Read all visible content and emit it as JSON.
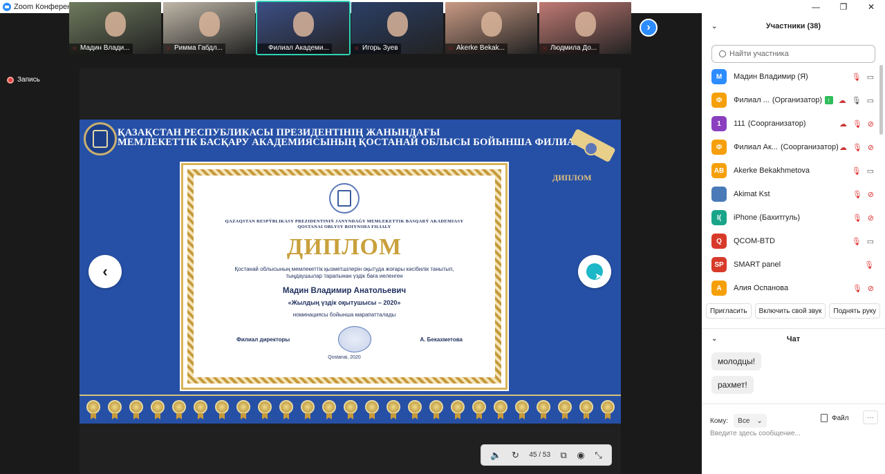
{
  "window": {
    "title": "Zoom Конференция"
  },
  "recording": {
    "label": "Запись"
  },
  "video_strip": [
    {
      "name": "Мадин Влади...",
      "bg": "#6f7a5e",
      "muted": true
    },
    {
      "name": "Римма Габдл...",
      "bg": "#bfb7a8",
      "muted": true
    },
    {
      "name": "Филиал Академи...",
      "bg": "#3c4f86",
      "muted": false
    },
    {
      "name": "Игорь Зуев",
      "bg": "#2b3f66",
      "muted": true
    },
    {
      "name": "Akerke Bekak...",
      "bg": "#c99a84",
      "muted": true
    },
    {
      "name": "Людмила До...",
      "bg": "#c07a74",
      "muted": true
    }
  ],
  "slide": {
    "header_line1": "ҚАЗАҚСТАН РЕСПУБЛИКАСЫ ПРЕЗИДЕНТІНІҢ ЖАНЫНДАҒЫ",
    "header_line2": "МЕМЛЕКЕТТІК БАСҚАРУ АКАДЕМИЯСЫНЫҢ ҚОСТАНАЙ ОБЛЫСЫ БОЙЫНША ФИЛИАЛЫ",
    "diplom_label": "ДИПЛОМ",
    "cert_org_line1": "QAZAQSTAN RESPÝBLIKASY PREZIDENTINIŃ JANYNDAǴY MEMLEKETTIK BASQARÝ AKADEMIASY",
    "cert_org_line2": "QOSTANAI OBLYSY BOIYNSHA FILIALY",
    "cert_title": "ДИПЛОМ",
    "cert_sub1": "Қостанай облысының мемлекеттік қызметшілерін оқытуда жоғары кәсібилік танытып,",
    "cert_sub2": "тыңдаушылар тарапынан үздік баға иеленген",
    "cert_person": "Мадин Владимир Анатольевич",
    "cert_nomination": "«Жылдың үздік оқытушысы – 2020»",
    "cert_award": "номинациясы бойынша марапатталады",
    "cert_director": "Филиал директоры",
    "cert_signer": "А. Бекахметова",
    "cert_place": "Qostanai, 2020"
  },
  "slide_toolbar": {
    "page": "45 / 53"
  },
  "participants": {
    "title": "Участники (38)",
    "search_placeholder": "Найти участника",
    "list": [
      {
        "initials": "М",
        "color": "#2d8cff",
        "name": "Мадин Владимир (Я)",
        "role": "",
        "icons": [
          "mic-off",
          "cam"
        ]
      },
      {
        "initials": "Ф",
        "color": "#f5a00a",
        "name": "Филиал ...",
        "role": "(Организатор)",
        "icons": [
          "upload",
          "cloud",
          "mic",
          "cam"
        ]
      },
      {
        "initials": "1",
        "color": "#8a3fbf",
        "name": "111",
        "role": "(Соорганизатор)",
        "icons": [
          "cloud",
          "mic-off",
          "cam-off"
        ]
      },
      {
        "initials": "Ф",
        "color": "#f5a00a",
        "name": "Филиал Ак...",
        "role": "(Соорганизатор)",
        "icons": [
          "cloud",
          "mic-off",
          "cam-off"
        ]
      },
      {
        "initials": "AB",
        "color": "#f5a00a",
        "name": "Akerke Bekakhmetova",
        "role": "",
        "icons": [
          "mic-off",
          "cam"
        ]
      },
      {
        "initials": "",
        "color": "#4a7ab8",
        "name": "Akimat Kst",
        "role": "",
        "icons": [
          "mic-off",
          "cam-off"
        ]
      },
      {
        "initials": "I(",
        "color": "#1aa58a",
        "name": "iPhone (Бахитгуль)",
        "role": "",
        "icons": [
          "mic-off",
          "cam-off"
        ]
      },
      {
        "initials": "Q",
        "color": "#d83a2a",
        "name": "QCOM-BTD",
        "role": "",
        "icons": [
          "mic-off",
          "cam"
        ]
      },
      {
        "initials": "SP",
        "color": "#d83a2a",
        "name": "SMART panel",
        "role": "",
        "icons": [
          "mic-off"
        ]
      },
      {
        "initials": "А",
        "color": "#f5a00a",
        "name": "Алия Оспанова",
        "role": "",
        "icons": [
          "mic-off",
          "cam-off"
        ]
      }
    ],
    "buttons": {
      "invite": "Пригласить",
      "unmute": "Включить свой звук",
      "raise": "Поднять руку"
    }
  },
  "chat": {
    "title": "Чат",
    "messages": [
      "молодцы!",
      "рахмет!"
    ],
    "to_label": "Кому:",
    "to_value": "Все",
    "file_label": "Файл",
    "more_label": "···",
    "input_placeholder": "Введите здесь сообщение..."
  },
  "window_controls": {
    "minimize": "—",
    "maximize": "❐",
    "close": "✕"
  }
}
